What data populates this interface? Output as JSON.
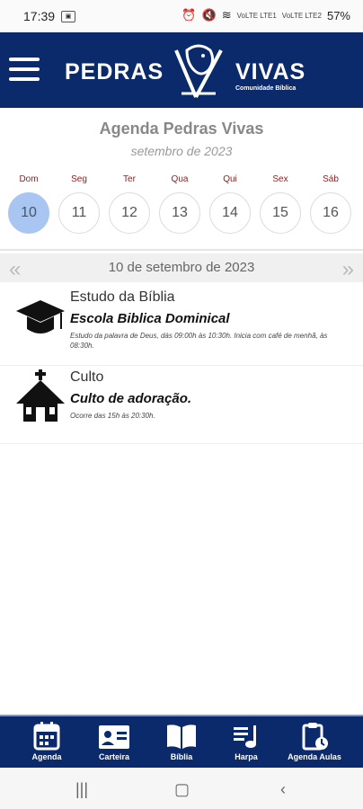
{
  "status": {
    "time": "17:39",
    "battery": "57%",
    "net1": "VoLTE LTE1",
    "net2": "VoLTE LTE2"
  },
  "header": {
    "brand_left": "PEDRAS",
    "brand_right": "VIVAS",
    "brand_sub": "Comunidade Bíblica"
  },
  "agenda": {
    "title": "Agenda Pedras Vivas",
    "month": "setembro de 2023"
  },
  "week": [
    {
      "name": "Dom",
      "num": "10"
    },
    {
      "name": "Seg",
      "num": "11"
    },
    {
      "name": "Ter",
      "num": "12"
    },
    {
      "name": "Qua",
      "num": "13"
    },
    {
      "name": "Qui",
      "num": "14"
    },
    {
      "name": "Sex",
      "num": "15"
    },
    {
      "name": "Sáb",
      "num": "16"
    }
  ],
  "nav": {
    "date": "10 de setembro de 2023"
  },
  "events": [
    {
      "category": "Estudo da Bíblia",
      "title": "Escola Biblica Dominical",
      "desc": "Estudo da palavra de Deus, dás 09:00h às 10:30h. Inicia com café de menhã, às 08:30h.",
      "icon": "graduation-cap-icon"
    },
    {
      "category": "Culto",
      "title": "Culto de adoração.",
      "desc": "Ocorre das 15h às 20:30h.",
      "icon": "church-icon"
    }
  ],
  "tabs": [
    {
      "label": "Agenda",
      "icon": "calendar-icon"
    },
    {
      "label": "Carteira",
      "icon": "id-card-icon"
    },
    {
      "label": "Bíblia",
      "icon": "bible-icon"
    },
    {
      "label": "Harpa",
      "icon": "music-note-icon"
    },
    {
      "label": "Agenda Aulas",
      "icon": "clipboard-clock-icon"
    }
  ],
  "colors": {
    "header": "#0a2a6b",
    "selected_day": "#a9c6f2",
    "day_name": "#8b1d1d"
  }
}
